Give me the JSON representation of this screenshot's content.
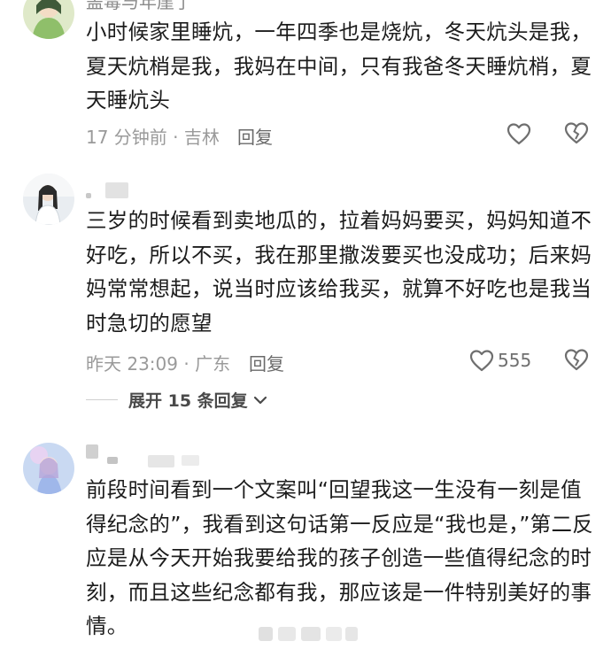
{
  "comments": [
    {
      "username": "盖毒与年崖了",
      "text": "小时候家里睡炕，一年四季也是烧炕，冬天炕头是我，夏天炕梢是我，我妈在中间，只有我爸冬天睡炕梢，夏天睡炕头",
      "meta": "17 分钟前 · 吉林",
      "reply_label": "回复",
      "like_count": ""
    },
    {
      "username": "",
      "text": "三岁的时候看到卖地瓜的，拉着妈妈要买，妈妈知道不好吃，所以不买，我在那里撒泼要买也没成功；后来妈妈常常想起，说当时应该给我买，就算不好吃也是我当时急切的愿望",
      "meta": "昨天 23:09 · 广东",
      "reply_label": "回复",
      "like_count": "555",
      "expand_label": "展开 15 条回复"
    },
    {
      "username": "",
      "text": "前段时间看到一个文案叫“回望我这一生没有一刻是值得纪念的”，我看到这句话第一反应是“我也是，”第二反应是从今天开始我要给我的孩子创造一些值得纪念的时刻，而且这些纪念都有我，那应该是一件特别美好的事情。"
    }
  ],
  "icons": {
    "like": "heart-outline-icon",
    "dislike": "broken-heart-icon",
    "expand": "chevron-down-icon"
  },
  "colors": {
    "text": "#1c1c1c",
    "meta": "#9a9a9a",
    "icon": "#6f6f6f"
  }
}
